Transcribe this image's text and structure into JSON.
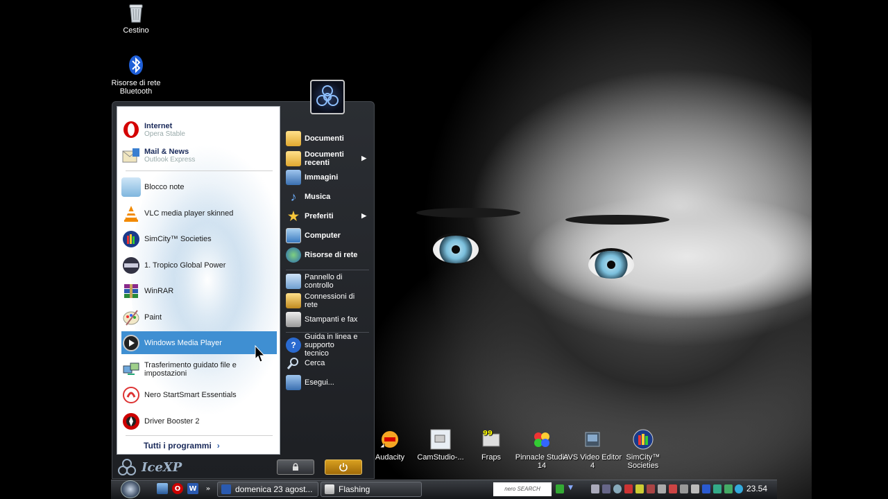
{
  "desktop": {
    "icons": [
      {
        "label": "Cestino",
        "icon": "recycle-bin-icon"
      },
      {
        "label": "Risorse di rete Bluetooth",
        "icon": "bluetooth-icon"
      }
    ],
    "shortcuts": [
      {
        "label": "Audacity",
        "icon": "audacity-icon"
      },
      {
        "label": "CamStudio-...",
        "icon": "camstudio-icon"
      },
      {
        "label": "Fraps",
        "icon": "fraps-icon"
      },
      {
        "label": "Pinnacle Studio 14",
        "icon": "pinnacle-icon"
      },
      {
        "label": "AVS Video Editor 4",
        "icon": "avs-icon"
      },
      {
        "label": "SimCity™ Societies",
        "icon": "simcity-icon"
      }
    ]
  },
  "start_menu": {
    "pinned": [
      {
        "title": "Internet",
        "subtitle": "Opera Stable",
        "icon": "opera-icon"
      },
      {
        "title": "Mail & News",
        "subtitle": "Outlook Express",
        "icon": "outlook-icon"
      }
    ],
    "recent": [
      {
        "label": "Blocco note",
        "icon": "notepad-icon"
      },
      {
        "label": "VLC media player skinned",
        "icon": "vlc-icon"
      },
      {
        "label": "SimCity™ Societies",
        "icon": "simcity-icon"
      },
      {
        "label": "1. Tropico Global Power",
        "icon": "tropico-icon"
      },
      {
        "label": "WinRAR",
        "icon": "winrar-icon"
      },
      {
        "label": "Paint",
        "icon": "paint-icon"
      },
      {
        "label": "Windows Media Player",
        "icon": "media-player-icon",
        "selected": true
      },
      {
        "label": "Trasferimento guidato file e impostazioni",
        "icon": "transfer-wizard-icon"
      },
      {
        "label": "Nero StartSmart Essentials",
        "icon": "nero-icon"
      },
      {
        "label": "Driver Booster 2",
        "icon": "driver-booster-icon"
      }
    ],
    "all_programs": "Tutti i programmi",
    "right": [
      {
        "label": "Documenti",
        "icon": "documents-icon",
        "bold": true
      },
      {
        "label": "Documenti recenti",
        "icon": "recent-documents-icon",
        "bold": true,
        "submenu": true
      },
      {
        "label": "Immagini",
        "icon": "pictures-icon",
        "bold": true
      },
      {
        "label": "Musica",
        "icon": "music-icon",
        "bold": true
      },
      {
        "label": "Preferiti",
        "icon": "favorites-icon",
        "bold": true,
        "submenu": true
      },
      {
        "label": "Computer",
        "icon": "computer-icon",
        "bold": true
      },
      {
        "label": "Risorse di rete",
        "icon": "network-icon",
        "bold": true
      },
      {
        "label": "Pannello di controllo",
        "icon": "control-panel-icon"
      },
      {
        "label": "Connessioni di rete",
        "icon": "network-connections-icon"
      },
      {
        "label": "Stampanti e fax",
        "icon": "printers-icon"
      },
      {
        "label": "Guida in linea e supporto tecnico",
        "icon": "help-icon"
      },
      {
        "label": "Cerca",
        "icon": "search-icon"
      },
      {
        "label": "Esegui...",
        "icon": "run-icon"
      }
    ],
    "theme_logo": "IceXP"
  },
  "taskbar": {
    "tasks": [
      {
        "label": "domenica 23 agost...",
        "icon": "word-document-icon"
      },
      {
        "label": "Flashing",
        "icon": "folder-icon"
      }
    ],
    "nero_search": "nero SEARCH",
    "clock": "23.54"
  }
}
